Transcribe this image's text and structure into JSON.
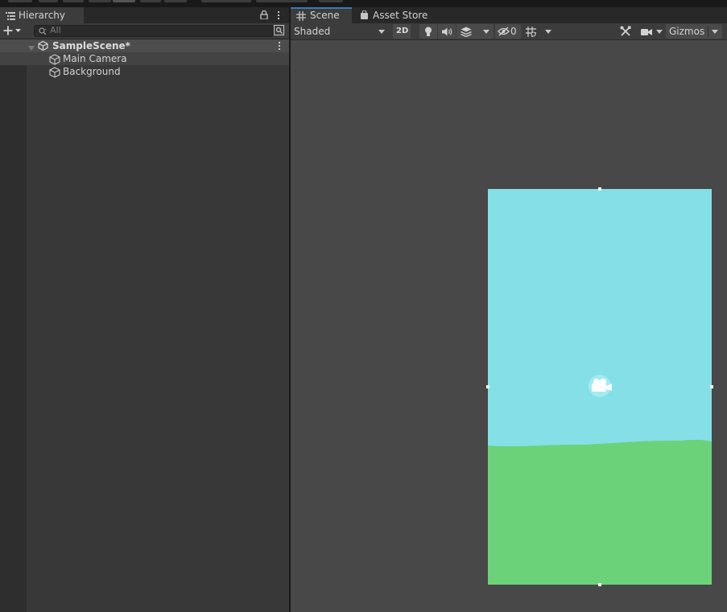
{
  "hierarchy": {
    "tab_label": "Hierarchy",
    "search_placeholder": "All",
    "items": [
      {
        "label": "SampleScene*",
        "type": "scene"
      },
      {
        "label": "Main Camera",
        "type": "gameobject"
      },
      {
        "label": "Background",
        "type": "gameobject"
      }
    ]
  },
  "scene_view": {
    "tabs": [
      {
        "label": "Scene",
        "icon": "grid-icon",
        "active": true
      },
      {
        "label": "Asset Store",
        "icon": "bag-icon",
        "active": false
      }
    ],
    "toolbar": {
      "shading_mode": "Shaded",
      "mode_2d_label": "2D",
      "hidden_objects_count": "0",
      "gizmos_label": "Gizmos"
    }
  },
  "colors": {
    "sky": "#84dfe6",
    "grass": "#6bd27a",
    "viewport": "#484848",
    "accent": "#3a79bb"
  }
}
